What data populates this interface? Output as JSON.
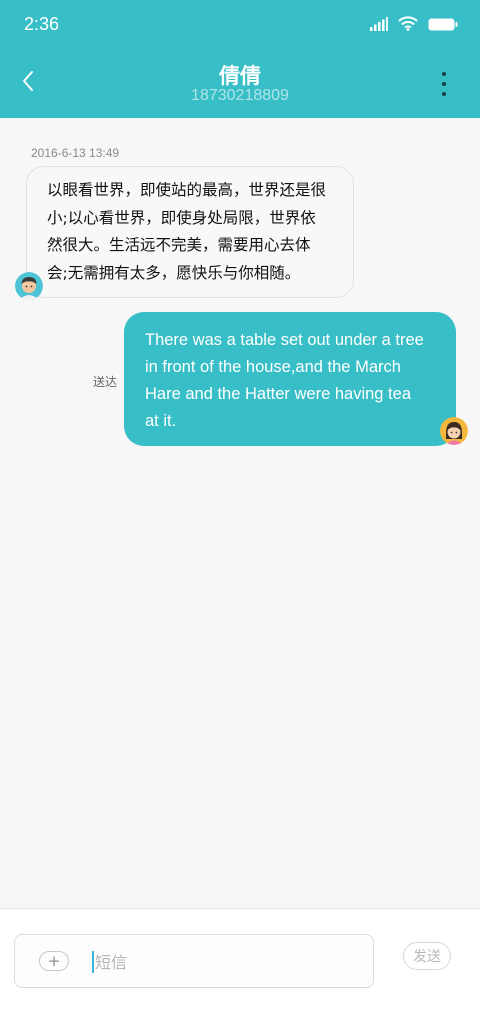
{
  "status_bar": {
    "time": "2:36",
    "icons": [
      "signal-icon",
      "wifi-icon",
      "battery-icon"
    ]
  },
  "header": {
    "back_icon": "chevron-left-icon",
    "contact_name": "倩倩",
    "contact_number": "18730218809",
    "more_icon": "more-vertical-icon"
  },
  "conversation": {
    "timestamp": "2016-6-13 13:49",
    "incoming": {
      "lines": [
        "以眼看世界，即使站的最高，世界还是很",
        "小;以心看世界，即使身处局限，世界依",
        "然很大。生活远不完美，需要用心去体",
        "会;无需拥有太多，愿快乐与你相随。"
      ],
      "avatar": "male-avatar"
    },
    "outgoing": {
      "lines": [
        "There was a table set out under a tree",
        "in front of the house,and the March",
        "Hare and the Hatter were having tea",
        "at it."
      ],
      "status": "送达",
      "avatar": "female-avatar"
    }
  },
  "composer": {
    "attach_label": "+",
    "placeholder": "短信",
    "value": "",
    "send_label": "发送"
  },
  "colors": {
    "accent": "#38bec6",
    "background": "#f7f7f7",
    "incoming_bubble": "#f8f8f8"
  }
}
